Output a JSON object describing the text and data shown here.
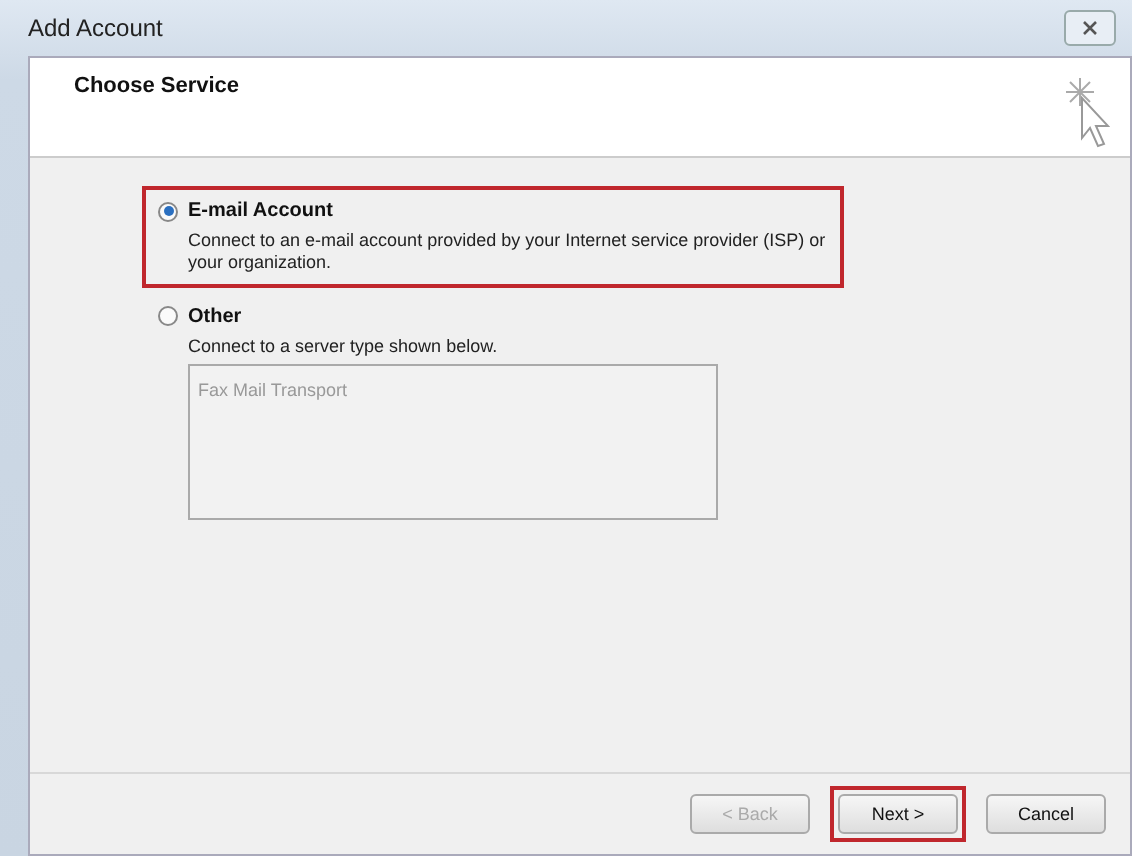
{
  "window": {
    "title": "Add Account"
  },
  "header": {
    "title": "Choose Service"
  },
  "options": [
    {
      "label": "E-mail Account",
      "description": "Connect to an e-mail account provided by your Internet service provider (ISP) or your organization.",
      "selected": true,
      "highlighted": true
    },
    {
      "label": "Other",
      "description": "Connect to a server type shown below.",
      "selected": false,
      "highlighted": false,
      "list": [
        "Fax Mail Transport"
      ]
    }
  ],
  "buttons": [
    {
      "label": "< Back",
      "disabled": true,
      "highlighted": false
    },
    {
      "label": "Next >",
      "disabled": false,
      "highlighted": true
    },
    {
      "label": "Cancel",
      "disabled": false,
      "highlighted": false
    }
  ]
}
